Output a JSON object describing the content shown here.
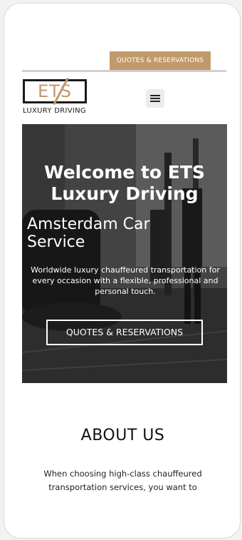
{
  "header": {
    "cta_label": "QUOTES & RESERVATIONS",
    "logo_letters": "ETS",
    "logo_tagline": "LUXURY DRIVING",
    "menu_icon": "hamburger-menu-icon"
  },
  "hero": {
    "title": "Welcome to ETS\nLuxury Driving",
    "subtitle": "Amsterdam Car\nService",
    "description": "Worldwide luxury chauffeured transportation for every occasion with a flexible, professional and personal touch.",
    "cta_label": "QUOTES & RESERVATIONS"
  },
  "about": {
    "title": "ABOUT US",
    "text": "When choosing high-class chauffeured transportation services, you want to"
  },
  "colors": {
    "accent_gold": "#c19a6b",
    "dark": "#1a1a1a",
    "white": "#ffffff"
  }
}
